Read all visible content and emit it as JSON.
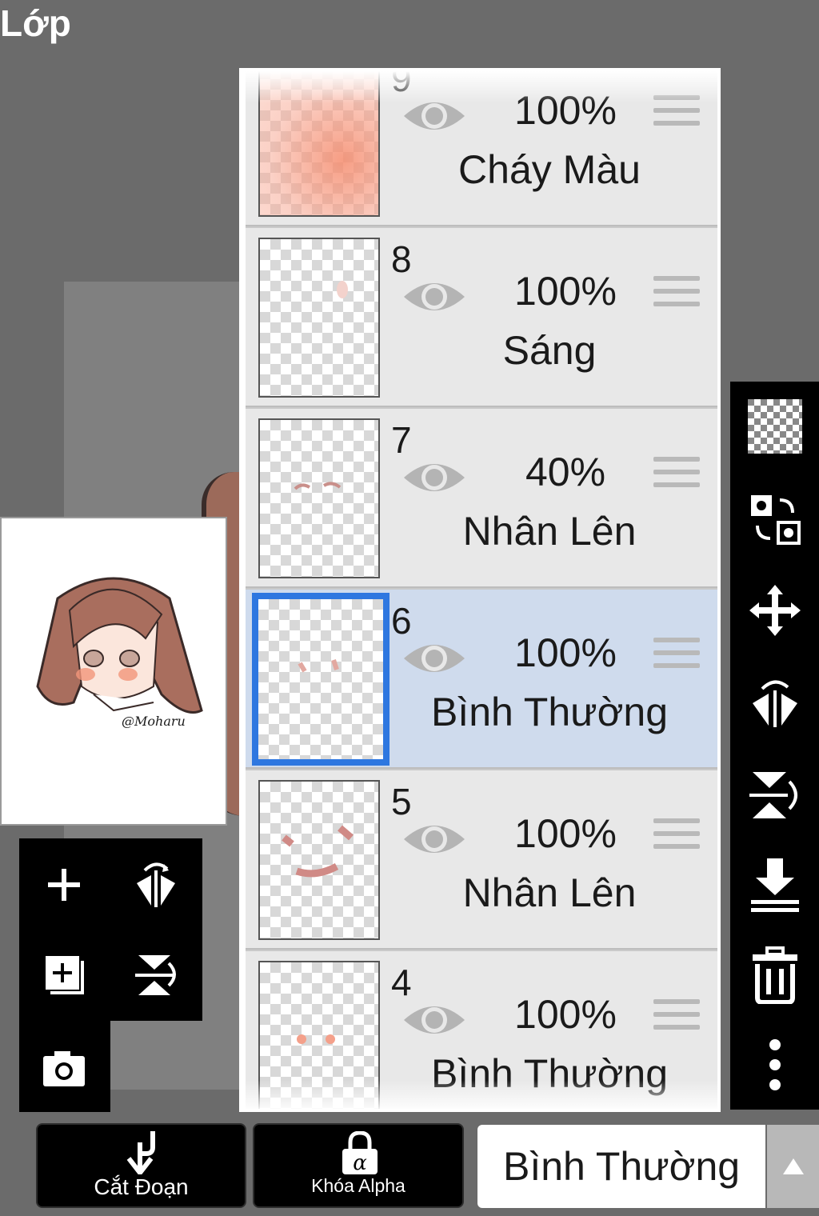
{
  "header": {
    "title": "Lớp"
  },
  "preview": {
    "signature": "@Moharu"
  },
  "layers": [
    {
      "number": "9",
      "opacity": "100%",
      "blend": "Cháy Màu",
      "selected": false
    },
    {
      "number": "8",
      "opacity": "100%",
      "blend": "Sáng",
      "selected": false
    },
    {
      "number": "7",
      "opacity": "40%",
      "blend": "Nhân Lên",
      "selected": false
    },
    {
      "number": "6",
      "opacity": "100%",
      "blend": "Bình Thường",
      "selected": true
    },
    {
      "number": "5",
      "opacity": "100%",
      "blend": "Nhân Lên",
      "selected": false
    },
    {
      "number": "4",
      "opacity": "100%",
      "blend": "Bình Thường",
      "selected": false
    }
  ],
  "left_tools": [
    "add-layer-icon",
    "flip-horizontal-icon",
    "duplicate-layer-icon",
    "flip-vertical-icon",
    "camera-icon"
  ],
  "right_tools": [
    "transparency-icon",
    "swap-icon",
    "move-icon",
    "flip-horizontal-icon",
    "flip-vertical-icon",
    "merge-down-icon",
    "trash-icon",
    "more-icon"
  ],
  "bottom": {
    "clip_label": "Cắt Đoạn",
    "alpha_lock_label": "Khóa Alpha",
    "blend_mode_value": "Bình Thường"
  },
  "colors": {
    "selected_border": "#2e77e0",
    "selected_bg": "#cfdbed",
    "layer_bg": "#e8e8e8",
    "app_bg": "#6b6b6b"
  }
}
